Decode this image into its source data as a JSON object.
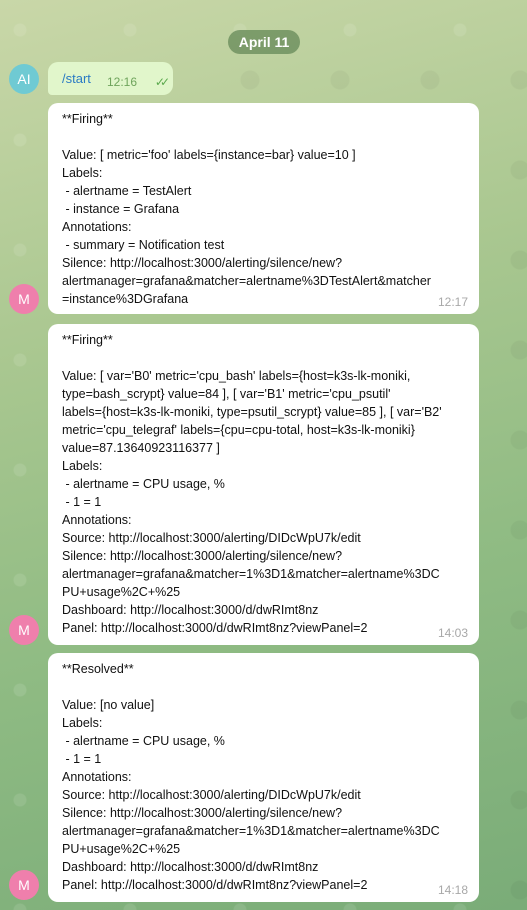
{
  "chat": {
    "date": "April 11",
    "messages": [
      {
        "avatar": "AI",
        "text": "/start",
        "time": "12:16",
        "status_icon": "double-check-icon"
      },
      {
        "avatar": "M",
        "time": "12:17",
        "text": "**Firing**\n\nValue: [ metric='foo' labels={instance=bar} value=10 ]\nLabels:\n - alertname = TestAlert\n - instance = Grafana\nAnnotations:\n - summary = Notification test\nSilence: http://localhost:3000/alerting/silence/new?\nalertmanager=grafana&matcher=alertname%3DTestAlert&matcher\n=instance%3DGrafana"
      },
      {
        "avatar": "M",
        "time": "14:03",
        "text": "**Firing**\n\nValue: [ var='B0' metric='cpu_bash' labels={host=k3s-lk-moniki,\ntype=bash_scrypt} value=84 ], [ var='B1' metric='cpu_psutil'\nlabels={host=k3s-lk-moniki, type=psutil_scrypt} value=85 ], [ var='B2'\nmetric='cpu_telegraf' labels={cpu=cpu-total, host=k3s-lk-moniki}\nvalue=87.13640923116377 ]\nLabels:\n - alertname = CPU usage, %\n - 1 = 1\nAnnotations:\nSource: http://localhost:3000/alerting/DIDcWpU7k/edit\nSilence: http://localhost:3000/alerting/silence/new?\nalertmanager=grafana&matcher=1%3D1&matcher=alertname%3DC\nPU+usage%2C+%25\nDashboard: http://localhost:3000/d/dwRImt8nz\nPanel: http://localhost:3000/d/dwRImt8nz?viewPanel=2"
      },
      {
        "avatar": "M",
        "time": "14:18",
        "text": "**Resolved**\n\nValue: [no value]\nLabels:\n - alertname = CPU usage, %\n - 1 = 1\nAnnotations:\nSource: http://localhost:3000/alerting/DIDcWpU7k/edit\nSilence: http://localhost:3000/alerting/silence/new?\nalertmanager=grafana&matcher=1%3D1&matcher=alertname%3DC\nPU+usage%2C+%25\nDashboard: http://localhost:3000/d/dwRImt8nz\nPanel: http://localhost:3000/d/dwRImt8nz?viewPanel=2"
      }
    ]
  },
  "colors": {
    "outgoing_bubble": "#e1f6cb",
    "incoming_bubble": "#ffffff",
    "avatar_ai": "#6fcad3",
    "avatar_m": "#ef7fac",
    "link": "#2a7bc4"
  }
}
